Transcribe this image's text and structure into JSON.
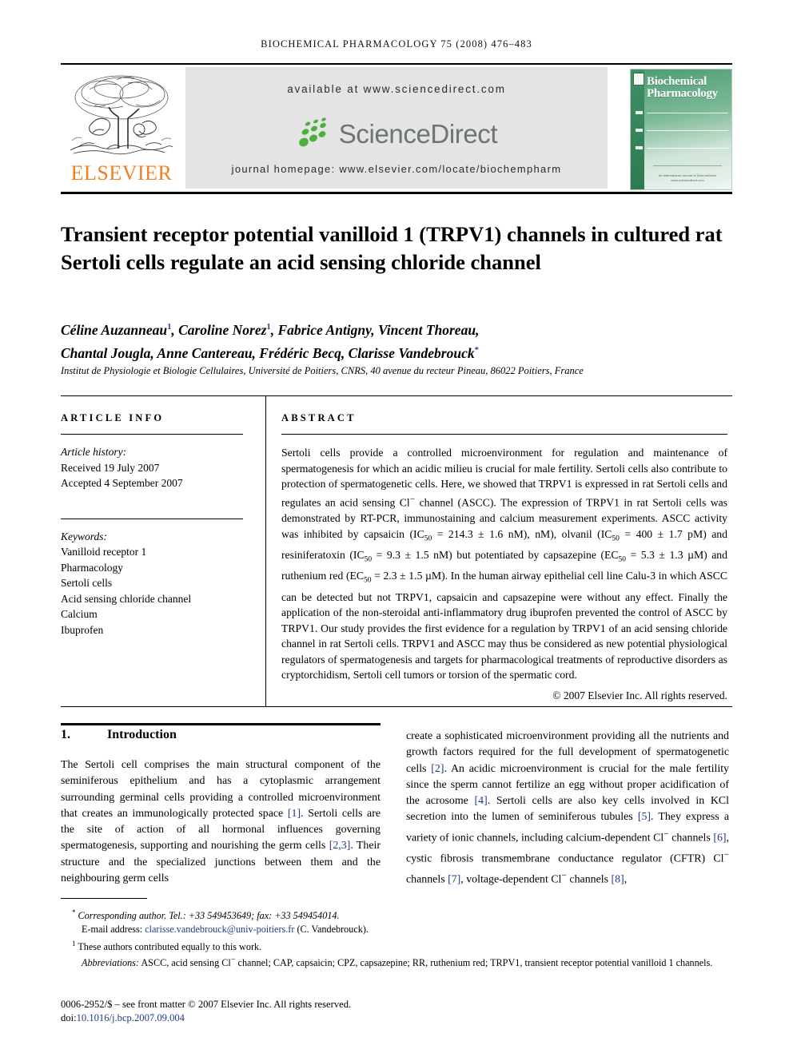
{
  "running_head": "Biochemical Pharmacology 75 (2008) 476–483",
  "masthead": {
    "publisher_name": "ELSEVIER",
    "publisher_logo": "elsevier-tree-logo",
    "available_at": "available at www.sciencedirect.com",
    "sciencedirect_logo_text": "ScienceDirect",
    "journal_homepage": "journal homepage: www.elsevier.com/locate/biochempharm",
    "cover": {
      "line1": "Biochemical",
      "line2": "Pharmacology",
      "footer": "An International Journal of\nScienceDirect\nwww.sciencedirect.com"
    },
    "colors": {
      "elsevier_orange": "#f08122",
      "sciencedirect_green": "#4caf3f",
      "sciencedirect_gray": "#6d7475",
      "bar_gray": "#e4e4e4",
      "cover_green": "#4e9c72"
    }
  },
  "article": {
    "title": "Transient receptor potential vanilloid 1 (TRPV1) channels in cultured rat Sertoli cells regulate an acid sensing chloride channel",
    "authors_line1_a": "Céline Auzanneau",
    "authors_line1_b": ", Caroline Norez",
    "authors_line1_c": ", Fabrice Antigny, Vincent Thoreau,",
    "authors_line2": "Chantal Jougla, Anne Cantereau, Frédéric Becq, Clarisse Vandebrouck",
    "author_mark_1": "1",
    "author_mark_star": "*",
    "affiliation": "Institut de Physiologie et Biologie Cellulaires, Université de Poitiers, CNRS, 40 avenue du recteur Pineau, 86022 Poitiers, France"
  },
  "article_info": {
    "heading": "ARTICLE INFO",
    "history_label": "Article history:",
    "received": "Received 19 July 2007",
    "accepted": "Accepted 4 September 2007",
    "keywords_label": "Keywords:",
    "keywords": [
      "Vanilloid receptor 1",
      "Pharmacology",
      "Sertoli cells",
      "Acid sensing chloride channel",
      "Calcium",
      "Ibuprofen"
    ]
  },
  "abstract": {
    "heading": "ABSTRACT",
    "paragraph_part1": "Sertoli cells provide a controlled microenvironment for regulation and maintenance of spermatogenesis for which an acidic milieu is crucial for male fertility. Sertoli cells also contribute to protection of spermatogenetic cells. Here, we showed that TRPV1 is expressed in rat Sertoli cells and regulates an acid sensing Cl",
    "paragraph_part2": " channel (ASCC). The expression of TRPV1 in rat Sertoli cells was demonstrated by RT-PCR, immunostaining and calcium measurement experiments. ASCC activity was inhibited by capsaicin (IC",
    "ic50_a": "50",
    "paragraph_part3": " = 214.3 ± 1.6 nM), nM), olvanil (IC",
    "ic50_b": "50",
    "paragraph_part4": " = 400 ± 1.7 pM) and resiniferatoxin (IC",
    "ic50_c": "50",
    "paragraph_part5": " = 9.3 ± 1.5 nM) but potentiated by capsazepine (EC",
    "ec50_a": "50",
    "paragraph_part6": " = 5.3 ± 1.3 µM) and ruthenium red (EC",
    "ec50_b": "50",
    "paragraph_part7": " = 2.3 ± 1.5 µM). In the human airway epithelial cell line Calu-3 in which ASCC can be detected but not TRPV1, capsaicin and capsazepine were without any effect. Finally the application of the non-steroidal anti-inflammatory drug ibuprofen prevented the control of ASCC by TRPV1. Our study provides the first evidence for a regulation by TRPV1 of an acid sensing chloride channel in rat Sertoli cells. TRPV1 and ASCC may thus be considered as new potential physiological regulators of spermatogenesis and targets for pharmacological treatments of reproductive disorders as cryptorchidism, Sertoli cell tumors or torsion of the spermatic cord.",
    "copyright": "© 2007 Elsevier Inc. All rights reserved."
  },
  "introduction": {
    "number": "1.",
    "heading": "Introduction",
    "left_part1": "The Sertoli cell comprises the main structural component of the seminiferous epithelium and has a cytoplasmic arrangement surrounding germinal cells providing a controlled microenvironment that creates an immunologically protected space ",
    "cite_1": "[1]",
    "left_part2": ". Sertoli cells are the site of action of all hormonal influences governing spermatogenesis, supporting and nourishing the germ cells ",
    "cite_23": "[2,3]",
    "left_part3": ". Their structure and the specialized junctions between them and the neighbouring germ cells",
    "right_part1": "create a sophisticated microenvironment providing all the nutrients and growth factors required for the full development of spermatogenetic cells ",
    "cite_2": "[2]",
    "right_part2": ". An acidic microenvironment is crucial for the male fertility since the sperm cannot fertilize an egg without proper acidification of the acrosome ",
    "cite_4": "[4]",
    "right_part3": ". Sertoli cells are also key cells involved in KCl secretion into the lumen of seminiferous tubules ",
    "cite_5": "[5]",
    "right_part4": ". They express a variety of ionic channels, including calcium-dependent Cl",
    "right_part5": " channels ",
    "cite_6": "[6]",
    "right_part6": ", cystic fibrosis transmembrane conductance regulator (CFTR) Cl",
    "right_part7": " channels ",
    "cite_7": "[7]",
    "right_part8": ", voltage-dependent Cl",
    "right_part9": " channels ",
    "cite_8": "[8]",
    "right_part10": ","
  },
  "footnotes": {
    "star_mark": "*",
    "corresponding": "Corresponding author. Tel.: +33 549453649; fax: +33 549454014.",
    "email_label": "E-mail address:",
    "email": "clarisse.vandebrouck@univ-poitiers.fr",
    "email_owner": "(C. Vandebrouck).",
    "one_mark": "1",
    "equal_contrib": "These authors contributed equally to this work.",
    "abbrev_label": "Abbreviations:",
    "abbrev_part1": " ASCC, acid sensing Cl",
    "abbrev_part2": " channel; CAP, capsaicin; CPZ, capsazepine; RR, ruthenium red; TRPV1, transient receptor potential vanilloid 1 channels.",
    "issn_line": "0006-2952/$ – see front matter © 2007 Elsevier Inc. All rights reserved.",
    "doi_label": "doi:",
    "doi": "10.1016/j.bcp.2007.09.004"
  }
}
